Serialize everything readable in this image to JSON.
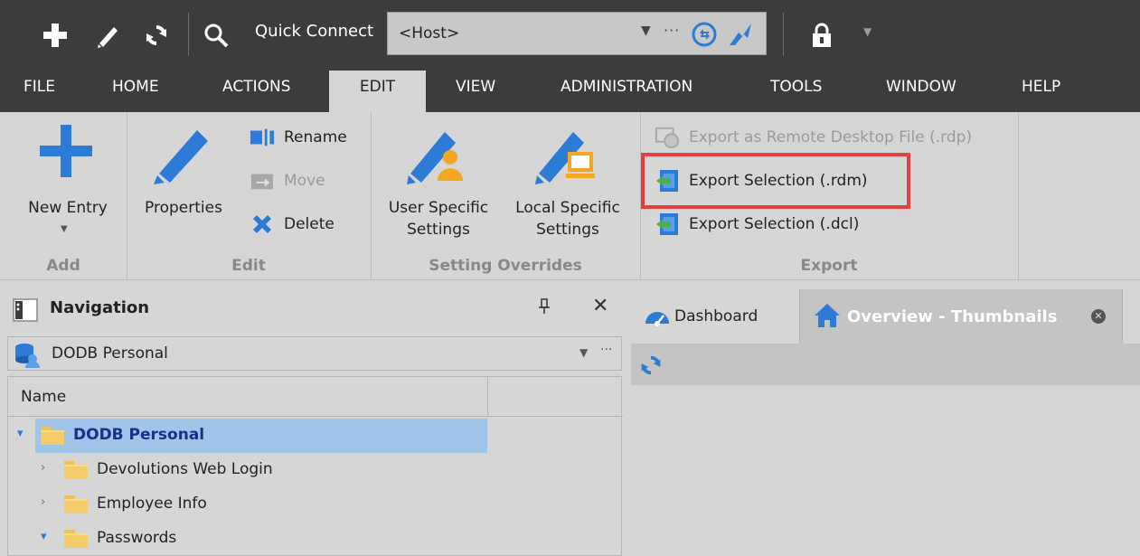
{
  "quick_connect": {
    "label": "Quick Connect",
    "host_placeholder": "<Host>"
  },
  "menu": [
    "FILE",
    "HOME",
    "ACTIONS",
    "EDIT",
    "VIEW",
    "ADMINISTRATION",
    "TOOLS",
    "WINDOW",
    "HELP"
  ],
  "active_menu": "EDIT",
  "ribbon": {
    "add": {
      "new_entry": "New Entry",
      "group": "Add"
    },
    "edit": {
      "properties": "Properties",
      "rename": "Rename",
      "move": "Move",
      "delete": "Delete",
      "group": "Edit"
    },
    "overrides": {
      "user_line1": "User Specific",
      "user_line2": "Settings",
      "local_line1": "Local Specific",
      "local_line2": "Settings",
      "group": "Setting Overrides"
    },
    "export": {
      "rdp": "Export as Remote Desktop File (.rdp)",
      "rdm": "Export Selection (.rdm)",
      "dcl": "Export Selection (.dcl)",
      "group": "Export"
    }
  },
  "navigation": {
    "title": "Navigation",
    "datasource": "DODB Personal",
    "column_name": "Name",
    "tree": [
      {
        "label": "DODB Personal",
        "expanded": true,
        "selected": true,
        "level": 0
      },
      {
        "label": "Devolutions Web Login",
        "expanded": false,
        "level": 1
      },
      {
        "label": "Employee Info",
        "expanded": false,
        "level": 1
      },
      {
        "label": "Passwords",
        "expanded": true,
        "level": 1
      }
    ]
  },
  "tabs": {
    "dashboard": "Dashboard",
    "overview": "Overview - Thumbnails"
  },
  "colors": {
    "toolbar_bg": "#3c3c3c",
    "accent_blue": "#2c7bd6",
    "highlight": "#e53f3f",
    "selection": "#9ec4e8"
  }
}
